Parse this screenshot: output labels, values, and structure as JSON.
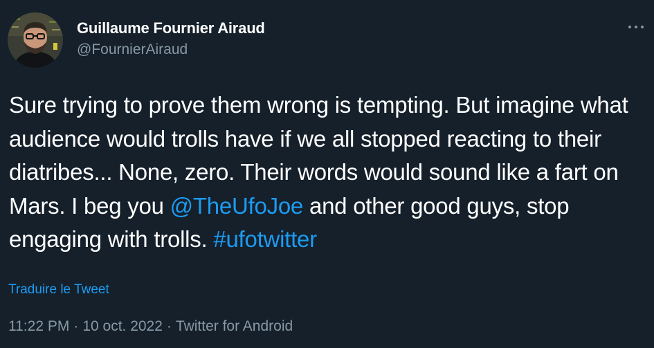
{
  "author": {
    "display_name": "Guillaume Fournier Airaud",
    "handle": "@FournierAiraud",
    "avatar_icon": "person-with-glasses-avatar"
  },
  "more_icon": "more-horizontal-icon",
  "tweet": {
    "segments": [
      {
        "text": "Sure trying to prove them wrong is tempting. But imagine what audience would trolls have if we all stopped reacting to their diatribes... None, zero. Their words would sound like a fart on Mars. I beg you ",
        "type": "text"
      },
      {
        "text": "@TheUfoJoe",
        "type": "mention"
      },
      {
        "text": " and other good guys, stop engaging with trolls. ",
        "type": "text"
      },
      {
        "text": "#ufotwitter",
        "type": "hashtag"
      }
    ]
  },
  "translate_label": "Traduire le Tweet",
  "meta": {
    "time": "11:22 PM",
    "separator": "·",
    "date": "10 oct. 2022",
    "source": "Twitter for Android"
  },
  "colors": {
    "background": "#15202b",
    "text": "#ffffff",
    "secondary": "#8899a6",
    "link": "#1d9bf0"
  }
}
